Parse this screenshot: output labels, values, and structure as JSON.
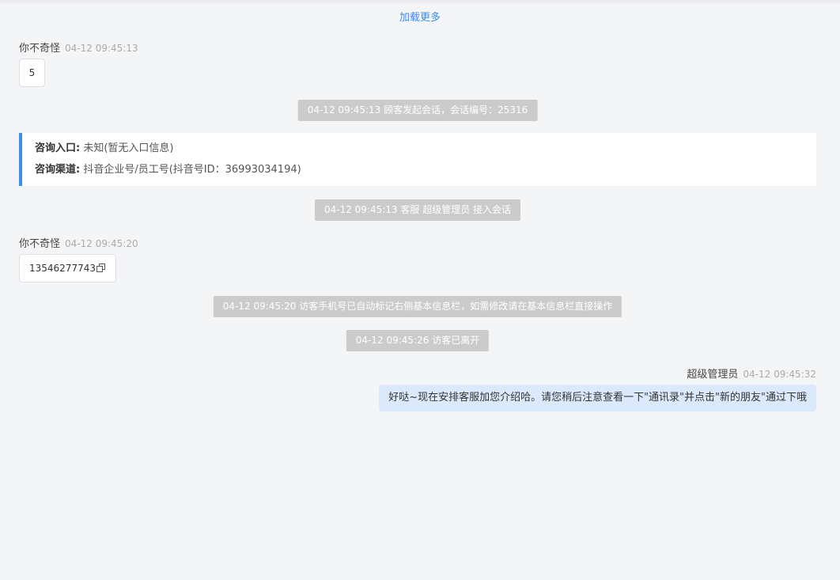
{
  "load_more": "加载更多",
  "messages": [
    {
      "sender": "你不奇怪",
      "time": "04-12 09:45:13",
      "text": "5"
    },
    {
      "sender": "你不奇怪",
      "time": "04-12 09:45:20",
      "text": "13546277743"
    }
  ],
  "system": [
    "04-12 09:45:13 顾客发起会话，会话编号：25316",
    "04-12 09:45:13 客服 超级管理员 接入会话",
    "04-12 09:45:20 访客手机号已自动标记右侧基本信息栏，如需修改请在基本信息栏直接操作",
    "04-12 09:45:26 访客已离开"
  ],
  "info_card": {
    "entry_label": "咨询入口:",
    "entry_value": "未知(暂无入口信息)",
    "channel_label": "咨询渠道:",
    "channel_value": "抖音企业号/员工号(抖音号ID：36993034194)"
  },
  "agent_message": {
    "sender": "超级管理员",
    "time": "04-12 09:45:32",
    "text": "好哒~现在安排客服加您介绍哈。请您稍后注意查看一下\"通讯录\"并点击\"新的朋友\"通过下哦"
  },
  "icons": {
    "copy": "copy-icon"
  },
  "colors": {
    "background": "#f4f5f7",
    "accent": "#3a8ee6",
    "system_bg": "#cbcbcb",
    "agent_bubble": "#dbe9fd"
  }
}
